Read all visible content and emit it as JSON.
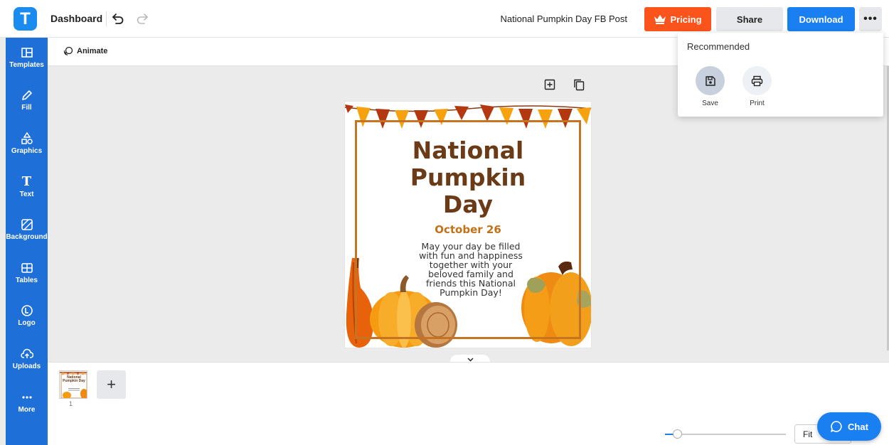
{
  "header": {
    "logo_letter": "T",
    "dashboard_label": "Dashboard",
    "document_title": "National Pumpkin Day FB Post",
    "pricing_label": "Pricing",
    "share_label": "Share",
    "download_label": "Download",
    "more_label": "•••"
  },
  "sidebar": {
    "items": [
      {
        "label": "Templates",
        "icon": "templates-icon"
      },
      {
        "label": "Fill",
        "icon": "pencil-icon"
      },
      {
        "label": "Graphics",
        "icon": "shapes-icon"
      },
      {
        "label": "Text",
        "icon": "text-icon"
      },
      {
        "label": "Background",
        "icon": "background-icon"
      },
      {
        "label": "Tables",
        "icon": "table-icon"
      },
      {
        "label": "Logo",
        "icon": "logo-icon"
      },
      {
        "label": "Uploads",
        "icon": "cloud-upload-icon"
      },
      {
        "label": "More",
        "icon": "more-dots-icon"
      }
    ]
  },
  "toolbar": {
    "animate_label": "Animate"
  },
  "design": {
    "title_lines": [
      "National",
      "Pumpkin",
      "Day"
    ],
    "date": "October 26",
    "body_lines": [
      "May your day be filled",
      "with fun and happiness",
      "together with your",
      "beloved family and",
      "friends this National",
      "Pumpkin Day!"
    ],
    "frame_color": "#c77422",
    "title_color": "#6b3a17",
    "date_color": "#c17217"
  },
  "download_panel": {
    "title": "Recommended",
    "options": [
      {
        "label": "Save",
        "icon": "save-icon"
      },
      {
        "label": "Print",
        "icon": "print-icon"
      }
    ]
  },
  "pages": {
    "page_number": "1",
    "add_page_label": "+",
    "thumb_title": "National Pumpkin Day"
  },
  "zoom": {
    "fit_label": "Fit",
    "level_fraction": 0.1
  },
  "chat": {
    "label": "Chat"
  },
  "colors": {
    "brand_blue": "#1a7ff0",
    "sidebar_blue": "#1f6fd8",
    "pricing_orange": "#fa541c"
  }
}
